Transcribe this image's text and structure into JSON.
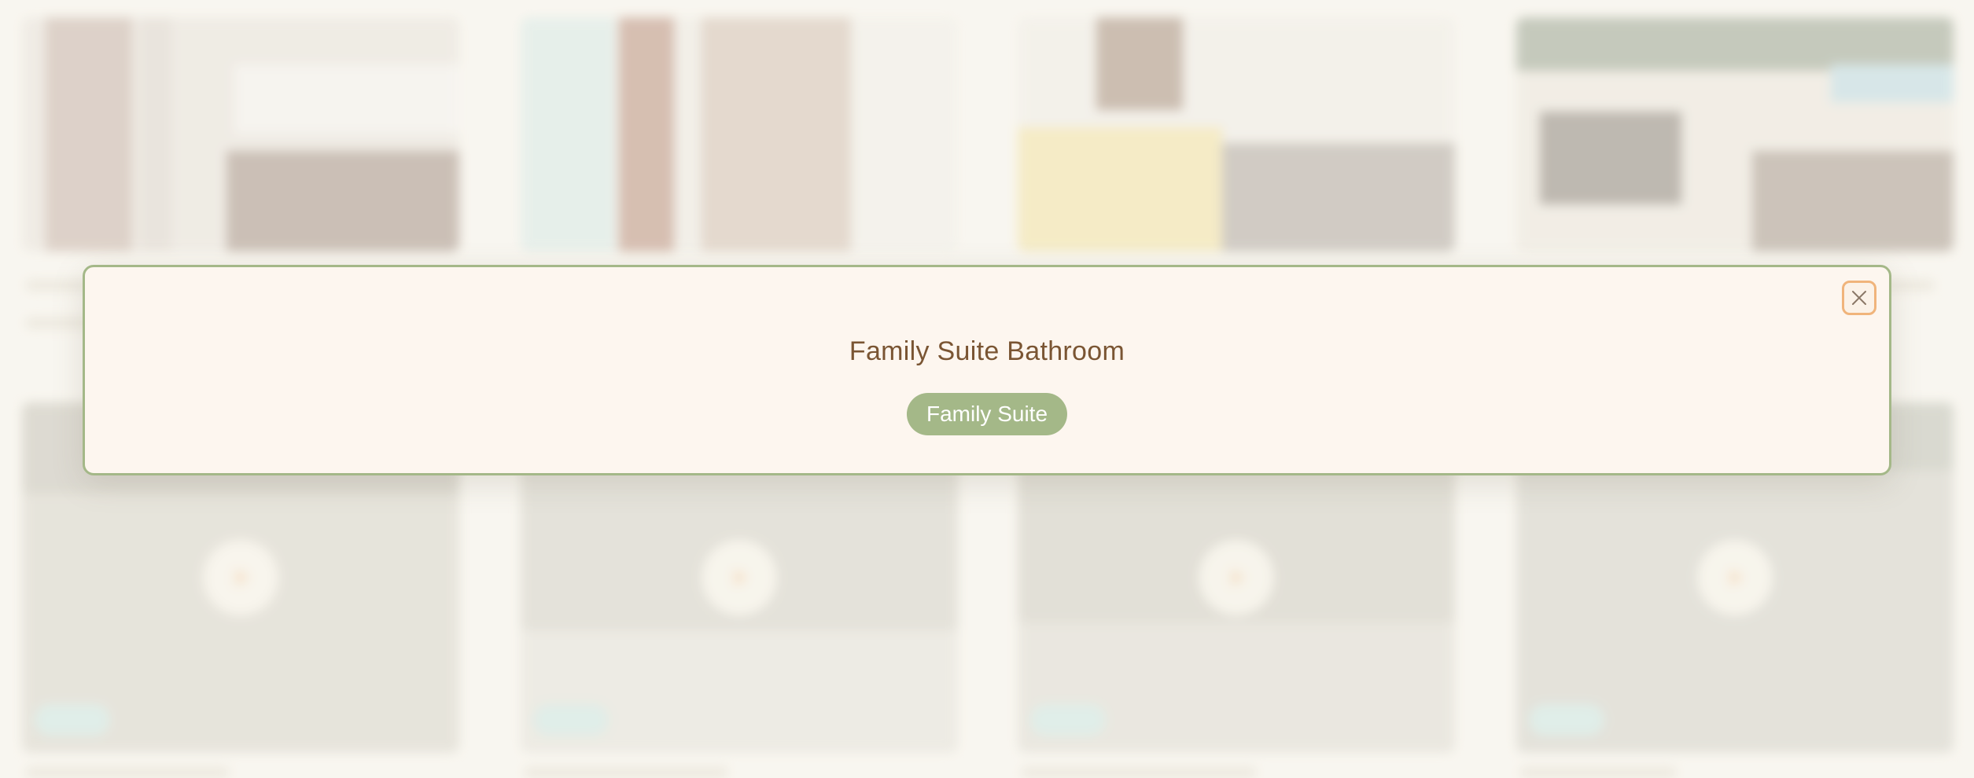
{
  "dialog": {
    "title": "Family Suite Bathroom",
    "category": "Family Suite",
    "close_icon": "close-icon"
  },
  "colors": {
    "page_background": "#f9f6f0",
    "dialog_background": "#fdf6ef",
    "dialog_border": "#a4b888",
    "title_text": "#7a5533",
    "chip_background": "#a4b888",
    "chip_text": "#ffffff",
    "close_border": "#f0b47b",
    "video_badge": "#bfe3e0",
    "play_icon": "#f3c28f"
  }
}
